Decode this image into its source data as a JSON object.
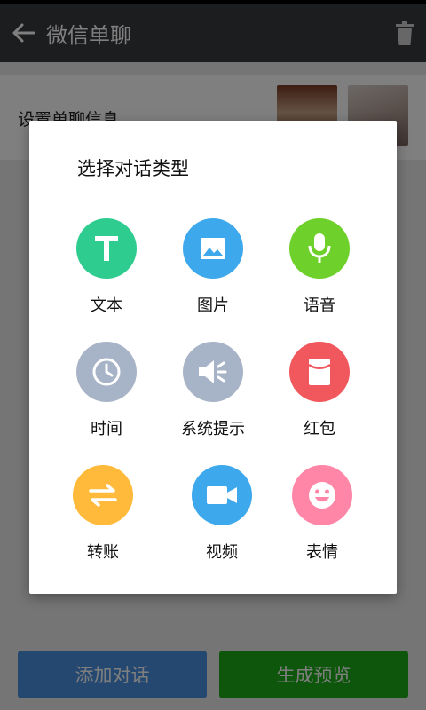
{
  "toolbar": {
    "title": "微信单聊"
  },
  "info": {
    "label": "设置单聊信息"
  },
  "bottom": {
    "add_label": "添加对话",
    "generate_label": "生成预览"
  },
  "dialog": {
    "title": "选择对话类型",
    "types": [
      {
        "label": "文本",
        "icon": "text-icon",
        "color": "#2ecc8f"
      },
      {
        "label": "图片",
        "icon": "image-icon",
        "color": "#3ea8ec"
      },
      {
        "label": "语音",
        "icon": "microphone-icon",
        "color": "#6ed02a"
      },
      {
        "label": "时间",
        "icon": "clock-icon",
        "color": "#a7b3c7"
      },
      {
        "label": "系统提示",
        "icon": "speaker-icon",
        "color": "#a7b3c7"
      },
      {
        "label": "红包",
        "icon": "red-envelope-icon",
        "color": "#f1585d"
      },
      {
        "label": "转账",
        "icon": "transfer-icon",
        "color": "#ffba3b"
      },
      {
        "label": "视频",
        "icon": "video-camera-icon",
        "color": "#3ea8ec"
      },
      {
        "label": "表情",
        "icon": "smiley-icon",
        "color": "#ff86a7"
      }
    ]
  }
}
